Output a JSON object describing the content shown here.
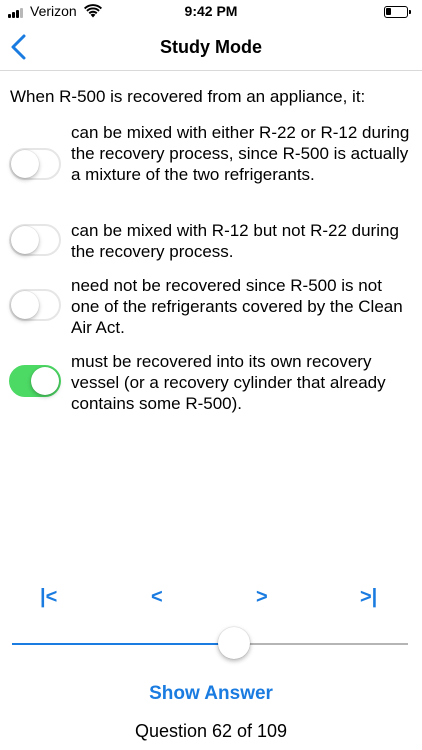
{
  "status_bar": {
    "carrier": "Verizon",
    "time": "9:42 PM",
    "battery_level": 0.3,
    "icons": [
      "signal-icon",
      "wifi-icon",
      "battery-icon"
    ]
  },
  "nav": {
    "title": "Study Mode",
    "back_icon": "chevron-left-icon"
  },
  "question": {
    "text": "When R-500 is recovered from an appliance, it:"
  },
  "options": [
    {
      "text": "can be mixed with either R-22 or R-12 during the recovery process, since R-500 is actually a mixture of the two refrigerants.",
      "selected": false
    },
    {
      "text": "can be mixed with R-12 but not R-22 during the recovery process.",
      "selected": false
    },
    {
      "text": "need not be recovered since R-500 is not one of the refrigerants covered by the Clean Air Act.",
      "selected": false
    },
    {
      "text": "must be recovered into its own recovery vessel (or a recovery cylinder that already contains some R-500).",
      "selected": true
    }
  ],
  "navigation": {
    "first": "|<",
    "prev": "<",
    "next": ">",
    "last": ">|"
  },
  "slider": {
    "value": 62,
    "min": 1,
    "max": 109
  },
  "show_answer_label": "Show Answer",
  "counter_text": "Question 62 of 109",
  "colors": {
    "accent": "#1a7be0",
    "toggle_on": "#4cd964"
  }
}
